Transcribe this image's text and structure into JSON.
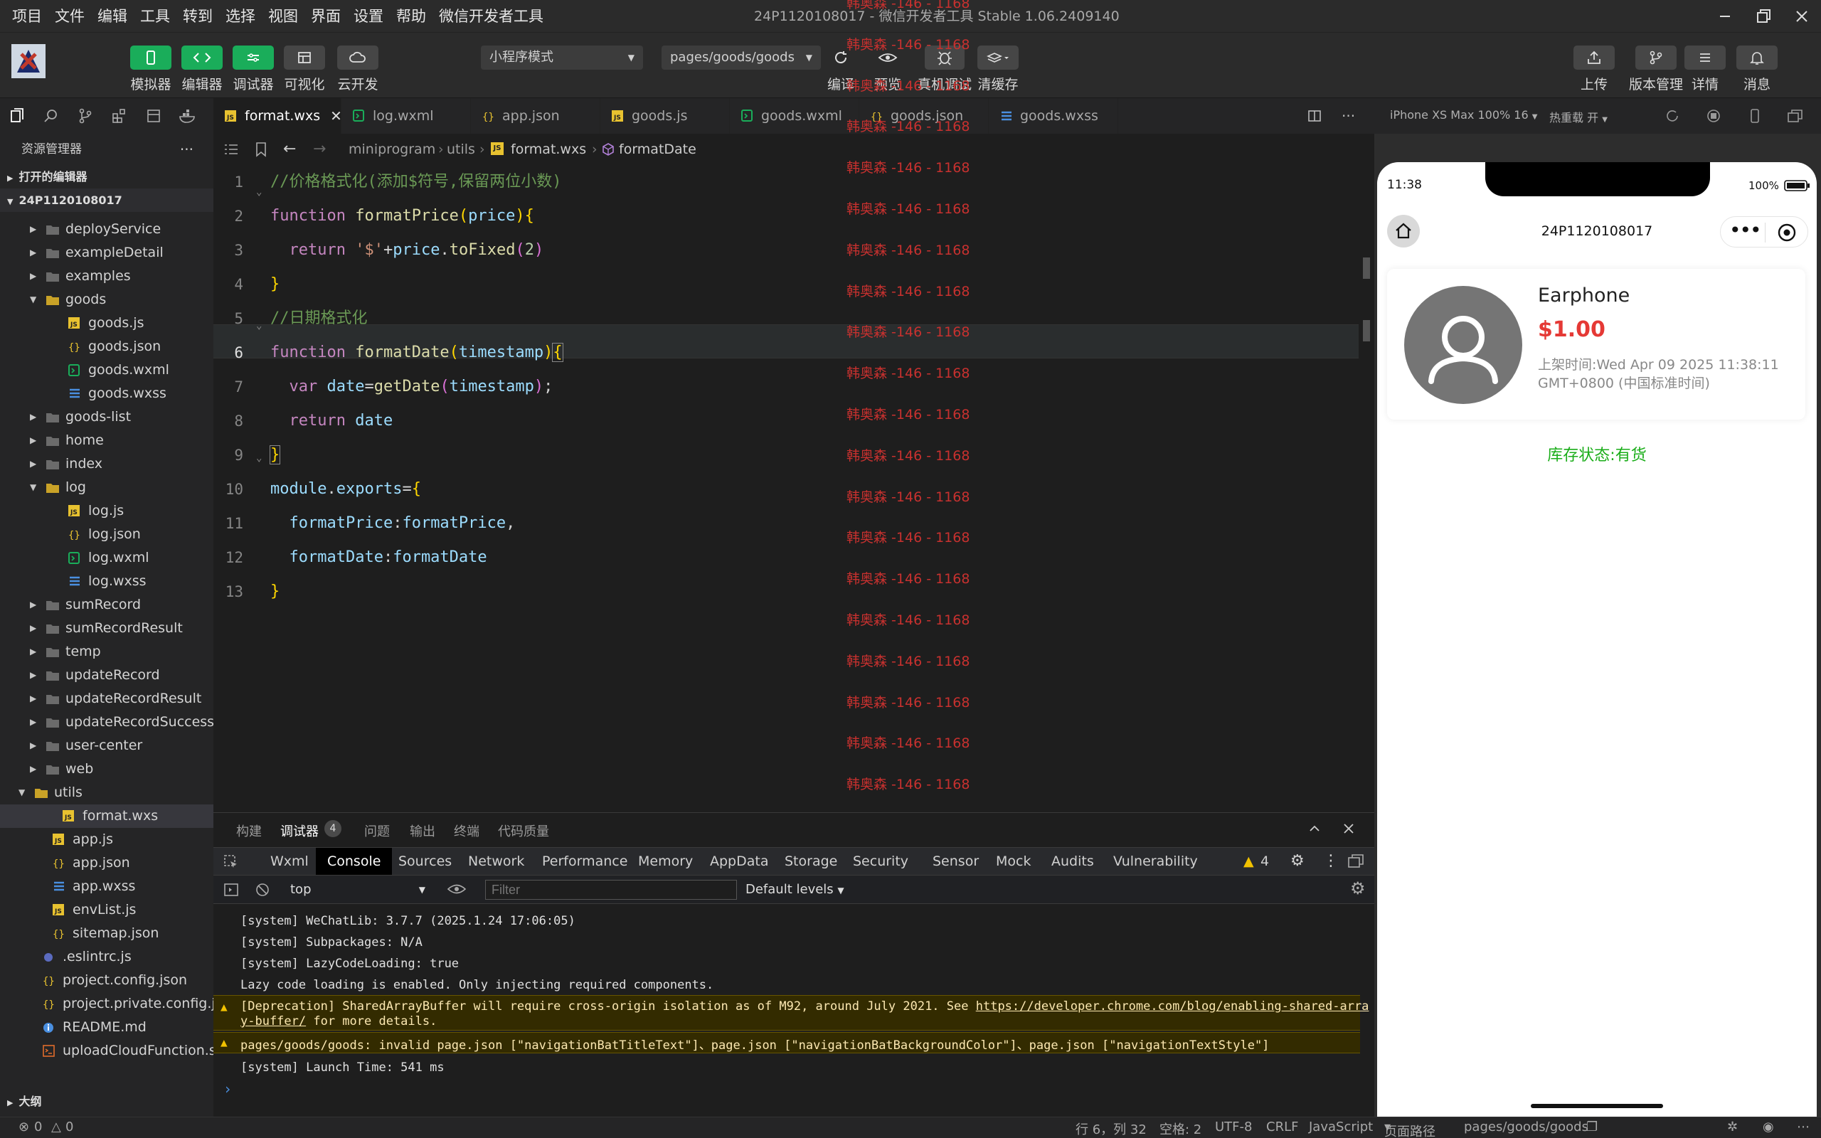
{
  "menu": [
    "项目",
    "文件",
    "编辑",
    "工具",
    "转到",
    "选择",
    "视图",
    "界面",
    "设置",
    "帮助",
    "微信开发者工具"
  ],
  "window_title": "24P1120108017 - 微信开发者工具 Stable 1.06.2409140",
  "toolbar": {
    "simulator": "模拟器",
    "editor": "编辑器",
    "debugger": "调试器",
    "visual": "可视化",
    "cloud": "云开发",
    "mode": "小程序模式",
    "page_path": "pages/goods/goods",
    "compile": "编译",
    "preview": "预览",
    "remote_debug": "真机调试",
    "clear_cache": "清缓存",
    "upload": "上传",
    "version": "版本管理",
    "details": "详情",
    "messages": "消息"
  },
  "sidebar": {
    "title": "资源管理器",
    "more": "···",
    "open_editors": "打开的编辑器",
    "project": "24P1120108017",
    "outline": "大纲",
    "items": [
      {
        "name": "deployService",
        "indent": 1,
        "type": "folder",
        "open": false
      },
      {
        "name": "exampleDetail",
        "indent": 1,
        "type": "folder",
        "open": false
      },
      {
        "name": "examples",
        "indent": 1,
        "type": "folder",
        "open": false
      },
      {
        "name": "goods",
        "indent": 1,
        "type": "folder",
        "open": true
      },
      {
        "name": "goods.js",
        "indent": 2,
        "type": "js"
      },
      {
        "name": "goods.json",
        "indent": 2,
        "type": "json"
      },
      {
        "name": "goods.wxml",
        "indent": 2,
        "type": "wxml"
      },
      {
        "name": "goods.wxss",
        "indent": 2,
        "type": "wxss"
      },
      {
        "name": "goods-list",
        "indent": 1,
        "type": "folder",
        "open": false
      },
      {
        "name": "home",
        "indent": 1,
        "type": "folder",
        "open": false
      },
      {
        "name": "index",
        "indent": 1,
        "type": "folder",
        "open": false
      },
      {
        "name": "log",
        "indent": 1,
        "type": "folder",
        "open": true
      },
      {
        "name": "log.js",
        "indent": 2,
        "type": "js"
      },
      {
        "name": "log.json",
        "indent": 2,
        "type": "json"
      },
      {
        "name": "log.wxml",
        "indent": 2,
        "type": "wxml"
      },
      {
        "name": "log.wxss",
        "indent": 2,
        "type": "wxss"
      },
      {
        "name": "sumRecord",
        "indent": 1,
        "type": "folder",
        "open": false
      },
      {
        "name": "sumRecordResult",
        "indent": 1,
        "type": "folder",
        "open": false
      },
      {
        "name": "temp",
        "indent": 1,
        "type": "folder",
        "open": false
      },
      {
        "name": "updateRecord",
        "indent": 1,
        "type": "folder",
        "open": false
      },
      {
        "name": "updateRecordResult",
        "indent": 1,
        "type": "folder",
        "open": false
      },
      {
        "name": "updateRecordSuccess",
        "indent": 1,
        "type": "folder",
        "open": false
      },
      {
        "name": "user-center",
        "indent": 1,
        "type": "folder",
        "open": false
      },
      {
        "name": "web",
        "indent": 1,
        "type": "folder",
        "open": false
      },
      {
        "name": "utils",
        "indent": 0,
        "type": "folder",
        "open": true
      },
      {
        "name": "format.wxs",
        "indent": 1,
        "type": "js",
        "selected": true
      },
      {
        "name": "app.js",
        "indent": 0,
        "type": "js"
      },
      {
        "name": "app.json",
        "indent": 0,
        "type": "json"
      },
      {
        "name": "app.wxss",
        "indent": 0,
        "type": "wxss"
      },
      {
        "name": "envList.js",
        "indent": 0,
        "type": "js"
      },
      {
        "name": "sitemap.json",
        "indent": 0,
        "type": "json"
      },
      {
        "name": ".eslintrc.js",
        "indent": -1,
        "type": "dot"
      },
      {
        "name": "project.config.json",
        "indent": -1,
        "type": "json"
      },
      {
        "name": "project.private.config.js...",
        "indent": -1,
        "type": "json"
      },
      {
        "name": "README.md",
        "indent": -1,
        "type": "info"
      },
      {
        "name": "uploadCloudFunction.sh",
        "indent": -1,
        "type": "sh"
      }
    ]
  },
  "tabs": [
    {
      "label": "format.wxs",
      "type": "js",
      "active": true
    },
    {
      "label": "log.wxml",
      "type": "wxml"
    },
    {
      "label": "app.json",
      "type": "json"
    },
    {
      "label": "goods.js",
      "type": "js"
    },
    {
      "label": "goods.wxml",
      "type": "wxml"
    },
    {
      "label": "goods.json",
      "type": "json"
    },
    {
      "label": "goods.wxss",
      "type": "wxss"
    }
  ],
  "breadcrumb": [
    "miniprogram",
    "utils",
    "format.wxs",
    "formatDate"
  ],
  "code_lines": [
    "1",
    "2",
    "3",
    "4",
    "5",
    "6",
    "7",
    "8",
    "9",
    "10",
    "11",
    "12",
    "13"
  ],
  "code": {
    "l1": "//价格格式化(添加$符号,保留两位小数)",
    "l5": "//日期格式化"
  },
  "watermark": "韩奥森 -146 - 1168",
  "panel": {
    "tabs": [
      "构建",
      "调试器",
      "问题",
      "输出",
      "终端",
      "代码质量"
    ],
    "badge": "4",
    "devtools_tabs": [
      "Wxml",
      "Console",
      "Sources",
      "Network",
      "Performance",
      "Memory",
      "AppData",
      "Storage",
      "Security",
      "Sensor",
      "Mock",
      "Audits",
      "Vulnerability"
    ],
    "warn_count": "4",
    "context": "top",
    "filter_placeholder": "Filter",
    "levels": "Default levels",
    "console": [
      "[system] WeChatLib: 3.7.7 (2025.1.24 17:06:05)",
      "[system] Subpackages: N/A",
      "[system] LazyCodeLoading: true",
      "Lazy code loading is enabled. Only injecting required components.",
      "[Deprecation] SharedArrayBuffer will require cross-origin isolation as of M92, around July 2021. See ",
      "https://developer.chrome.com/blog/enabling-shared-arra",
      "y-buffer/",
      " for more details.",
      "pages/goods/goods: invalid page.json [\"navigationBatTitleText\"]、page.json [\"navigationBatBackgroundColor\"]、page.json [\"navigationTextStyle\"]",
      "[system] Launch Time: 541 ms"
    ]
  },
  "simulator": {
    "device": "iPhone XS Max 100% 16",
    "hot_reload": "热重载 开",
    "time": "11:38",
    "battery": "100%",
    "nav_title": "24P1120108017",
    "product_name": "Earphone",
    "price": "$1.00",
    "listed_time": "上架时间:Wed Apr 09 2025 11:38:11 GMT+0800 (中国标准时间)",
    "stock": "库存状态:有货"
  },
  "statusbar": {
    "problems_err": "0",
    "problems_warn": "0",
    "position": "行 6，列 32",
    "spaces": "空格: 2",
    "encoding": "UTF-8",
    "eol": "CRLF",
    "language": "JavaScript",
    "page_path_label": "页面路径",
    "page_path": "pages/goods/goods"
  },
  "colors": {
    "accent_green": "#1aad5a",
    "price_red": "#e53935",
    "stock_green": "#1aad19",
    "watermark_red": "#c8312f"
  }
}
